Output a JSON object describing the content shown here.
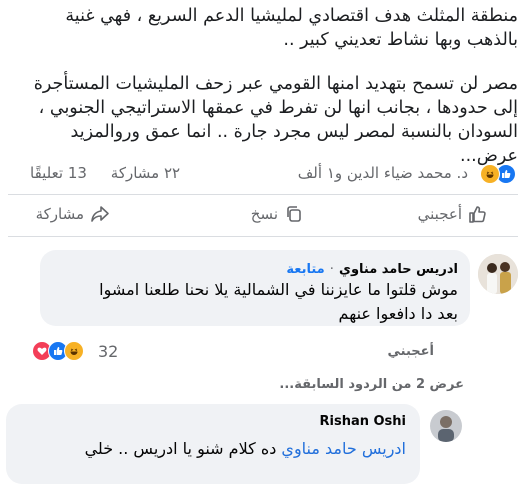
{
  "post": {
    "paragraph1_lines": [
      "منطقة المثلث هدف اقتصادي لمليشيا الدعم السريع ، فهي غنية",
      "بالذهب وبها نشاط تعديني كبير .."
    ],
    "paragraph2_lines": [
      "مصر لن تسمح بتهديد امنها القومي عبر زحف المليشيات المستأجرة",
      "إلى حدودها ، بجانب انها لن تفرط في عمقها الاستراتيجي الجنوبي ،",
      "السودان بالنسبة لمصر ليس مجرد جارة .. انما عمق وروالمزيد عرض..."
    ]
  },
  "stats": {
    "reactors": "د. محمد ضياء الدين و١ ألف",
    "comments": "13 تعليقًا",
    "shares": "٢٢ مشاركة"
  },
  "actions": {
    "like": "أعجبني",
    "copy": "نسخ",
    "share": "مشاركة"
  },
  "comment1": {
    "author": "ادريس حامد مناوي",
    "follow": "متابعة",
    "text_lines": [
      "موش قلتوا ما عايزننا في الشمالية يلا نحنا طلعنا امشوا",
      "بعد دا دافعوا عنهم"
    ],
    "reactions_count": "32",
    "like": "أعجبني"
  },
  "replies": {
    "view_previous": "عرض 2 من الردود السابقة..."
  },
  "comment2": {
    "author": "Rishan Oshi",
    "mention": "ادريس حامد مناوي",
    "text": "ده كلام شنو يا ادريس .. خلي"
  },
  "colors": {
    "like_blue": "#1877f2",
    "haha_yellow": "#f7b125",
    "love_red": "#f33e58",
    "bubble_gray": "#f0f2f5"
  }
}
